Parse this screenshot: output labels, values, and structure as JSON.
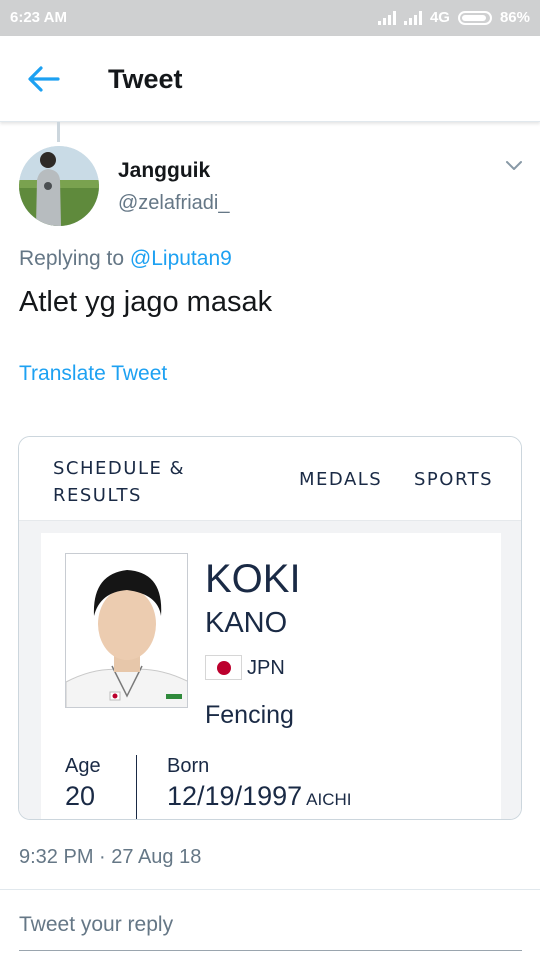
{
  "status_bar": {
    "time": "6:23 AM",
    "network": "4G",
    "battery": "86%"
  },
  "app_bar": {
    "title": "Tweet",
    "back_icon": "arrow-left-icon"
  },
  "tweet": {
    "author": {
      "name": "Jangguik",
      "handle": "@zelafriadi_"
    },
    "reply_prefix": "Replying to",
    "reply_to": "@Liputan9",
    "text": "Atlet yg jago masak",
    "translate_label": "Translate Tweet",
    "timestamp": "9:32 PM · 27 Aug 18"
  },
  "card": {
    "nav": {
      "schedule_line1": "SCHEDULE &",
      "schedule_line2": "RESULTS",
      "medals": "MEDALS",
      "sports": "SPORTS"
    },
    "athlete": {
      "first_name": "KOKI",
      "last_name": "KANO",
      "country": "JPN",
      "sport": "Fencing",
      "age_label": "Age",
      "age": "20",
      "born_label": "Born",
      "born_date": "12/19/1997",
      "born_place": "AICHI"
    }
  },
  "reply_box": {
    "placeholder": "Tweet your reply"
  },
  "colors": {
    "link_blue": "#1da1f2",
    "secondary_gray": "#657786",
    "navy": "#1a2a45",
    "status_bar": "#cfd0d1"
  }
}
